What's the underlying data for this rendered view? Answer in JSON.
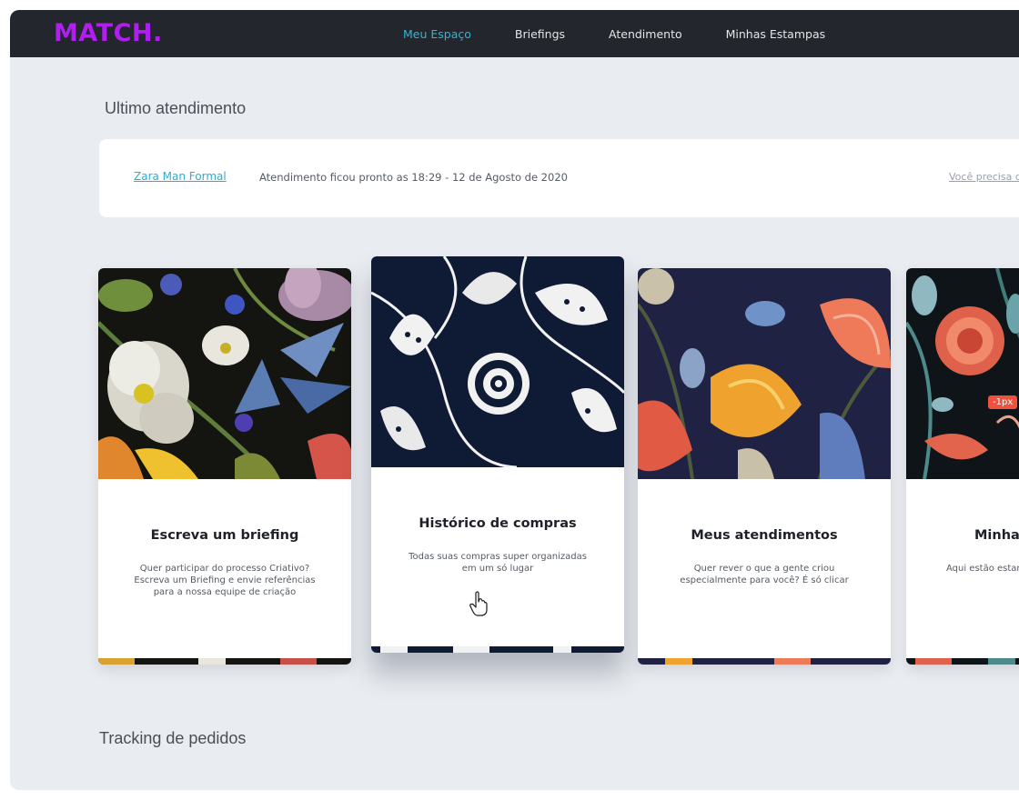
{
  "brand": {
    "logo": "MATCH.",
    "logo_color": "#b01ef0"
  },
  "nav": {
    "items": [
      {
        "label": "Meu Espaço",
        "active": true
      },
      {
        "label": "Briefings",
        "active": false
      },
      {
        "label": "Atendimento",
        "active": false
      },
      {
        "label": "Minhas Estampas",
        "active": false
      }
    ]
  },
  "last_service": {
    "section_title": "Ultimo atendimento",
    "name": "Zara Man Formal",
    "status": "Atendimento ficou pronto as 18:29 - 12 de Agosto de 2020",
    "help_link": "Você precisa d"
  },
  "cards": [
    {
      "title": "Escreva um briefing",
      "description": "Quer participar do processo Criativo? Escreva um Briefing e envie referências para a nossa equipe de criação"
    },
    {
      "title": "Histórico de compras",
      "description": "Todas suas compras super organizadas em um só lugar"
    },
    {
      "title": "Meus atendimentos",
      "description": "Quer rever o que a gente criou especialmente para você? É só clicar"
    },
    {
      "title": "Minhas",
      "description": "Aqui estão estam to",
      "badge": "-1px"
    }
  ],
  "tracking": {
    "section_title": "Tracking de pedidos"
  },
  "colors": {
    "accent": "#2fb6d6",
    "topbar": "#23262d",
    "background": "#e9ecf0",
    "badge": "#f0513c"
  }
}
